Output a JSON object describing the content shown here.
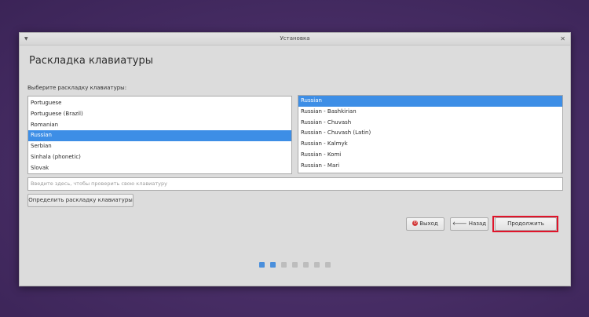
{
  "window": {
    "title": "Установка",
    "close_glyph": "✕",
    "menu_glyph": "▼"
  },
  "page": {
    "heading": "Раскладка клавиатуры",
    "prompt": "Выберите раскладку клавиатуры:"
  },
  "layouts": {
    "items": [
      "Portuguese",
      "Portuguese (Brazil)",
      "Romanian",
      "Russian",
      "Serbian",
      "Sinhala (phonetic)",
      "Slovak"
    ],
    "selected": "Russian"
  },
  "variants": {
    "items": [
      "Russian",
      "Russian - Bashkirian",
      "Russian - Chuvash",
      "Russian - Chuvash (Latin)",
      "Russian - Kalmyk",
      "Russian - Komi",
      "Russian - Mari"
    ],
    "selected": "Russian"
  },
  "test_field": {
    "placeholder": "Введите здесь, чтобы проверить свою клавиатуру"
  },
  "buttons": {
    "detect": "Определить раскладку клавиатуры",
    "exit": "Выход",
    "back": "Назад",
    "continue": "Продолжить"
  },
  "progress": {
    "total_steps": 7,
    "completed_steps": 2
  },
  "colors": {
    "selection": "#3d8ee6",
    "highlight": "#e0142a",
    "active_dot": "#4a8fdc"
  }
}
